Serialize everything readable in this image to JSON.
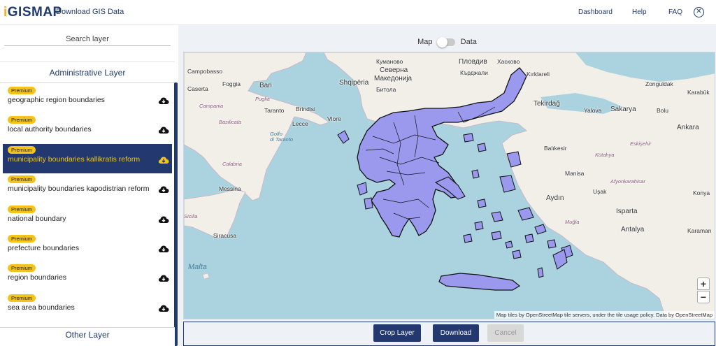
{
  "header": {
    "logo_mark": "i",
    "logo_text": "GISMAP",
    "title": "Download GIS Data",
    "nav": [
      "Dashboard",
      "Help",
      "FAQ"
    ]
  },
  "sidebar": {
    "search_placeholder": "Search layer",
    "admin_section": "Administrative Layer",
    "other_section": "Other Layer",
    "badge": "Premium",
    "layers": [
      {
        "label": "geographic region boundaries",
        "active": false
      },
      {
        "label": "local authority boundaries",
        "active": false
      },
      {
        "label": "municipality boundaries kallikratis reform",
        "active": true
      },
      {
        "label": "municipality boundaries kapodistrian reform",
        "active": false
      },
      {
        "label": "national boundary",
        "active": false
      },
      {
        "label": "prefecture boundaries",
        "active": false
      },
      {
        "label": "region boundaries",
        "active": false
      },
      {
        "label": "sea area boundaries",
        "active": false
      }
    ]
  },
  "view_toggle": {
    "left": "Map",
    "right": "Data",
    "selected": "Map"
  },
  "map": {
    "labels": {
      "campobasso": "Campobasso",
      "caserta": "Caserta",
      "foggia": "Foggia",
      "bari": "Bari",
      "taranto": "Taranto",
      "brindisi": "Brindisi",
      "lecce": "Lecce",
      "campania": "Campania",
      "puglia": "Puglia",
      "basilicata": "Basilicata",
      "calabria": "Calabria",
      "messina": "Messina",
      "sicilia": "Sicilia",
      "siracusa": "Siracusa",
      "malta": "Malta",
      "shqiperia": "Shqipëria",
      "vlore": "Vlorë",
      "bitola": "Битола",
      "severna": "Северна",
      "makedonija": "Македонија",
      "kumanovo": "Куманово",
      "plovdiv": "Пловдив",
      "kardzhali": "Кърджали",
      "haskovo": "Хасково",
      "kirklareli": "Kırklareli",
      "tekirdag": "Tekirdağ",
      "zonguldak": "Zonguldak",
      "karabuk": "Karabük",
      "sakarya": "Sakarya",
      "yalova": "Yalova",
      "bolu": "Bolu",
      "ankara": "Ankara",
      "eskisehir": "Eskişehir",
      "balikesir": "Balıkesir",
      "kutahya": "Kütahya",
      "manisa": "Manisa",
      "usak": "Uşak",
      "afyon": "Afyonkarahisar",
      "aydin": "Aydın",
      "isparta": "Isparta",
      "antalya": "Antalya",
      "karaman": "Karaman",
      "mugla": "Muğla",
      "konya": "Konya",
      "golfo": "Golfo\ndi Taranto"
    },
    "zoom_in": "+",
    "zoom_out": "−",
    "attribution": "Map tiles by OpenStreetMap tile servers, under the tile usage policy. Data by OpenStreetMap",
    "colors": {
      "sea": "#aad3df",
      "land": "#f2efe9",
      "greece_fill": "#9a99ee",
      "greece_stroke": "#111111"
    }
  },
  "actions": {
    "crop": "Crop Layer",
    "download": "Download",
    "cancel": "Cancel"
  }
}
